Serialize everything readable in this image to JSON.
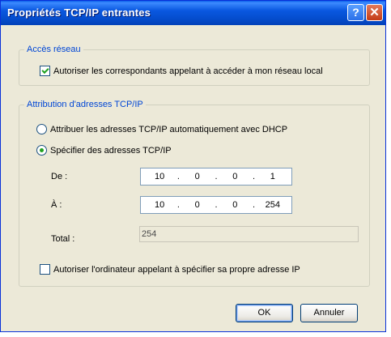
{
  "window": {
    "title": "Propriétés TCP/IP entrantes"
  },
  "titlebar_buttons": {
    "help": "?",
    "close": "✕"
  },
  "network_access": {
    "legend": "Accès réseau",
    "allow_local_access": {
      "label": "Autoriser les correspondants appelant à accéder à mon réseau local",
      "checked": true
    }
  },
  "tcpip_assignment": {
    "legend": "Attribution d'adresses TCP/IP",
    "options": [
      {
        "label": "Attribuer les adresses TCP/IP automatiquement avec DHCP",
        "selected": false
      },
      {
        "label": "Spécifier des adresses TCP/IP",
        "selected": true
      }
    ],
    "from": {
      "label": "De :",
      "octets": [
        "10",
        "0",
        "0",
        "1"
      ]
    },
    "to": {
      "label": "À :",
      "octets": [
        "10",
        "0",
        "0",
        "254"
      ]
    },
    "total": {
      "label": "Total :",
      "value": "254"
    },
    "allow_own_ip": {
      "label": "Autoriser l'ordinateur appelant à spécifier sa propre adresse IP",
      "checked": false
    }
  },
  "buttons": {
    "ok": "OK",
    "cancel": "Annuler"
  }
}
